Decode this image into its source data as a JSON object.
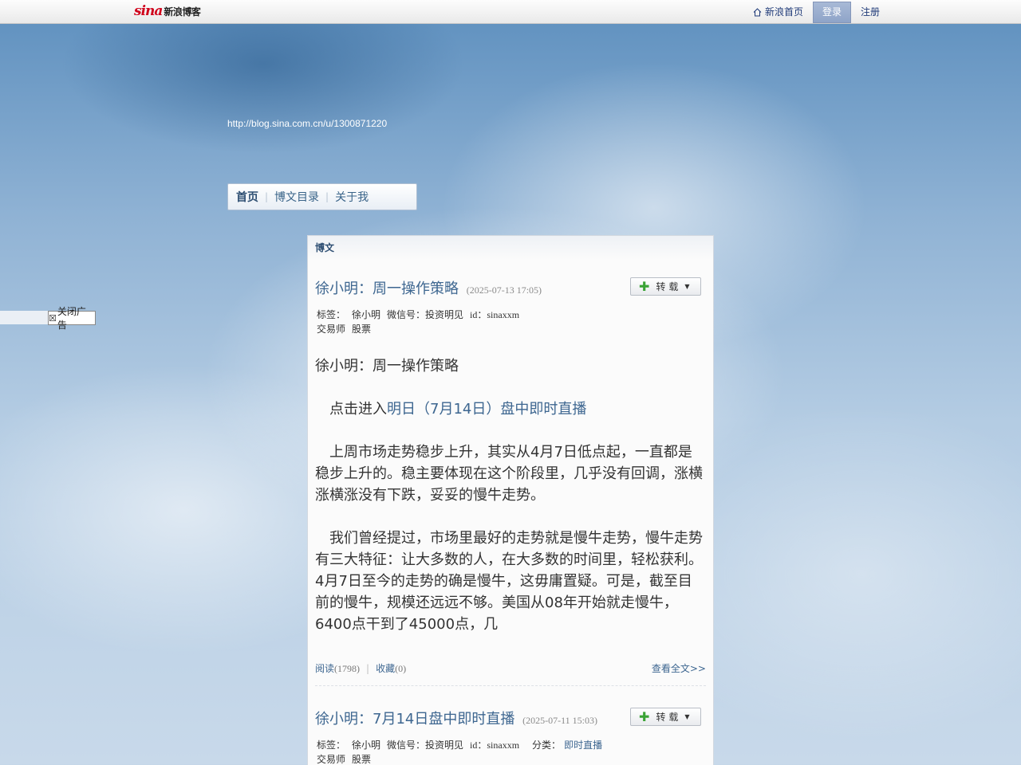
{
  "topbar": {
    "logo_mark": "sina",
    "logo_text": "新浪博客",
    "nav": {
      "home": "新浪首页",
      "login": "登录",
      "register": "注册"
    }
  },
  "blog": {
    "url": "http://blog.sina.com.cn/u/1300871220",
    "nav": {
      "home": "首页",
      "catalog": "博文目录",
      "about": "关于我"
    }
  },
  "ad": {
    "close_label": "关闭广告",
    "close_icon": "☒"
  },
  "panel": {
    "heading": "博文",
    "posts": [
      {
        "title": "徐小明：周一操作策略",
        "date": "(2025-07-13 17:05)",
        "repost_label": "转载",
        "tags_label": "标签：",
        "tags_line1": [
          "徐小明",
          "微信号：投资明见",
          "id：sinaxxm"
        ],
        "tags_line2": [
          "交易师",
          "股票"
        ],
        "body_title": "徐小明：周一操作策略",
        "body_prefix": "　点击进入",
        "body_link": "明日（7月14日）盘中即时直播",
        "para1": "　上周市场走势稳步上升，其实从4月7日低点起，一直都是稳步上升的。稳主要体现在这个阶段里，几乎没有回调，涨横涨横涨没有下跌，妥妥的慢牛走势。",
        "para2": "　我们曾经提过，市场里最好的走势就是慢牛走势，慢牛走势有三大特征：让大多数的人，在大多数的时间里，轻松获利。4月7日至今的走势的确是慢牛，这毋庸置疑。可是，截至目前的慢牛，规模还远远不够。美国从08年开始就走慢牛，6400点干到了45000点，几",
        "read_label": "阅读",
        "read_count": "(1798)",
        "fav_label": "收藏",
        "fav_count": "(0)",
        "more": "查看全文>>"
      },
      {
        "title": "徐小明：7月14日盘中即时直播",
        "date": "(2025-07-11 15:03)",
        "repost_label": "转载",
        "tags_label": "标签：",
        "tags_line1": [
          "徐小明",
          "微信号：投资明见",
          "id：sinaxxm"
        ],
        "category_label": "分类：",
        "category": "即时直播",
        "tags_line2": [
          "交易师",
          "股票"
        ]
      }
    ]
  }
}
